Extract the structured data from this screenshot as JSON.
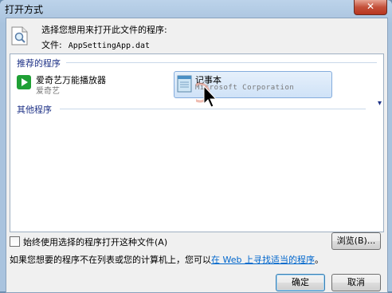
{
  "window": {
    "title": "打开方式",
    "close_glyph": "✕"
  },
  "header": {
    "prompt": "选择您想用来打开此文件的程序:",
    "file_label": "文件:",
    "file_name": "AppSettingApp.dat"
  },
  "recommended": {
    "heading": "推荐的程序",
    "programs": [
      {
        "name": "爱奇艺万能播放器",
        "publisher": "爱奇艺",
        "icon": "iqiyi-player-icon",
        "selected": false
      },
      {
        "name": "记事本",
        "publisher": "Microsoft Corporation",
        "icon": "notepad-icon",
        "selected": true
      }
    ]
  },
  "other": {
    "heading": "其他程序",
    "expand_icon": "chevron-down-icon"
  },
  "always_use": {
    "label": "始终使用选择的程序打开这种文件(A)",
    "checked": false
  },
  "browse_label": "浏览(B)...",
  "info": {
    "text": "如果您想要的程序不在列表或您的计算机上，您可以",
    "link": "在 Web 上寻找适当的程序",
    "suffix": "。"
  },
  "buttons": {
    "ok": "确定",
    "cancel": "取消"
  },
  "colors": {
    "accent": "#1e3287",
    "link": "#0066cc",
    "selection": "#cfe2f7",
    "close": "#c4503a"
  }
}
